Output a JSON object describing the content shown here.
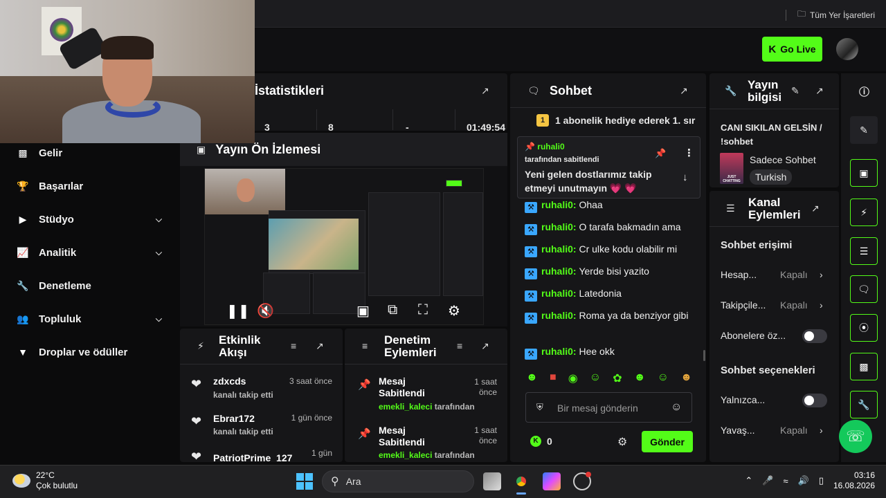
{
  "browser": {
    "bookmarks_label": "Tüm Yer İşaretleri"
  },
  "header": {
    "go_live": "Go Live"
  },
  "sidebar": {
    "items": [
      {
        "label": "Gelir",
        "icon": "bar-chart-icon",
        "has_chevron": false
      },
      {
        "label": "Başarılar",
        "icon": "trophy-icon",
        "has_chevron": false
      },
      {
        "label": "Stüdyo",
        "icon": "studio-icon",
        "has_chevron": true
      },
      {
        "label": "Analitik",
        "icon": "analytics-icon",
        "has_chevron": true
      },
      {
        "label": "Denetleme",
        "icon": "wrench-icon",
        "has_chevron": false
      },
      {
        "label": "Topluluk",
        "icon": "community-icon",
        "has_chevron": true
      },
      {
        "label": "Droplar ve ödüller",
        "icon": "drops-icon",
        "has_chevron": false
      }
    ]
  },
  "stats": {
    "title": "İstatistikleri",
    "values": [
      "3",
      "8",
      "-",
      "01:49:54"
    ]
  },
  "preview": {
    "title": "Yayın Ön İzlemesi"
  },
  "activity": {
    "title": "Etkinlik Akışı",
    "items": [
      {
        "name": "zdxcds",
        "action": "kanalı takip etti",
        "time": "3 saat önce"
      },
      {
        "name": "Ebrar172",
        "action": "kanalı takip etti",
        "time": "1 gün önce"
      },
      {
        "name": "PatriotPrime_127",
        "action": "",
        "time": "1 gün"
      }
    ]
  },
  "moderation": {
    "title": "Denetim Eylemleri",
    "items": [
      {
        "action": "Mesaj Sabitlendi",
        "user": "emekli_kaleci",
        "by": "tarafından",
        "time": "1 saat önce"
      },
      {
        "action": "Mesaj Sabitlendi",
        "user": "emekli_kaleci",
        "by": "tarafından",
        "time": "1 saat önce"
      }
    ]
  },
  "chat": {
    "title": "Sohbet",
    "gift_banner": "1 abonelik hediye ederek 1. sır",
    "gift_count": "1",
    "pinned": {
      "user": "ruhali0",
      "by": "tarafından sabitlendi",
      "text": "Yeni gelen dostlarımız takip etmeyi unutmayın 💗 💗"
    },
    "messages": [
      {
        "user": "ruhali0",
        "text": "Ohaa"
      },
      {
        "user": "ruhali0",
        "text": "O tarafa bakmadın ama"
      },
      {
        "user": "ruhali0",
        "text": "Cr ulke kodu olabilir mi"
      },
      {
        "user": "ruhali0",
        "text": "Yerde bisi yazito"
      },
      {
        "user": "ruhali0",
        "text": "Latedonia"
      },
      {
        "user": "ruhali0",
        "text": "Roma ya da benziyor gibi"
      },
      {
        "user": "ruhali0",
        "text": "Hee okk"
      }
    ],
    "input_placeholder": "Bir mesaj gönderin",
    "points": "0",
    "send_label": "Gönder"
  },
  "stream_info": {
    "title": "Yayın bilgisi",
    "stream_title": "CANI SIKILAN GELSİN / !sohbet",
    "category": "Sadece Sohbet",
    "language": "Turkish",
    "thumb_text": "JUST CHATTING"
  },
  "channel_actions": {
    "title": "Kanal Eylemleri",
    "chat_access_heading": "Sohbet erişimi",
    "chat_options_heading": "Sohbet seçenekleri",
    "rows": [
      {
        "label": "Hesap...",
        "value": "Kapalı",
        "kind": "select"
      },
      {
        "label": "Takipçile...",
        "value": "Kapalı",
        "kind": "select"
      },
      {
        "label": "Abonelere öz...",
        "value": "",
        "kind": "toggle"
      },
      {
        "label": "Yalnızca...",
        "value": "",
        "kind": "toggle"
      },
      {
        "label": "Yavaş...",
        "value": "Kapalı",
        "kind": "select"
      }
    ]
  },
  "taskbar": {
    "temperature": "22°C",
    "weather": "Çok bulutlu",
    "search_placeholder": "Ara",
    "time": "03:16",
    "date": "16.08.2026"
  },
  "colors": {
    "accent": "#53fc18",
    "panel": "#161618",
    "background": "#0b0b0c"
  }
}
